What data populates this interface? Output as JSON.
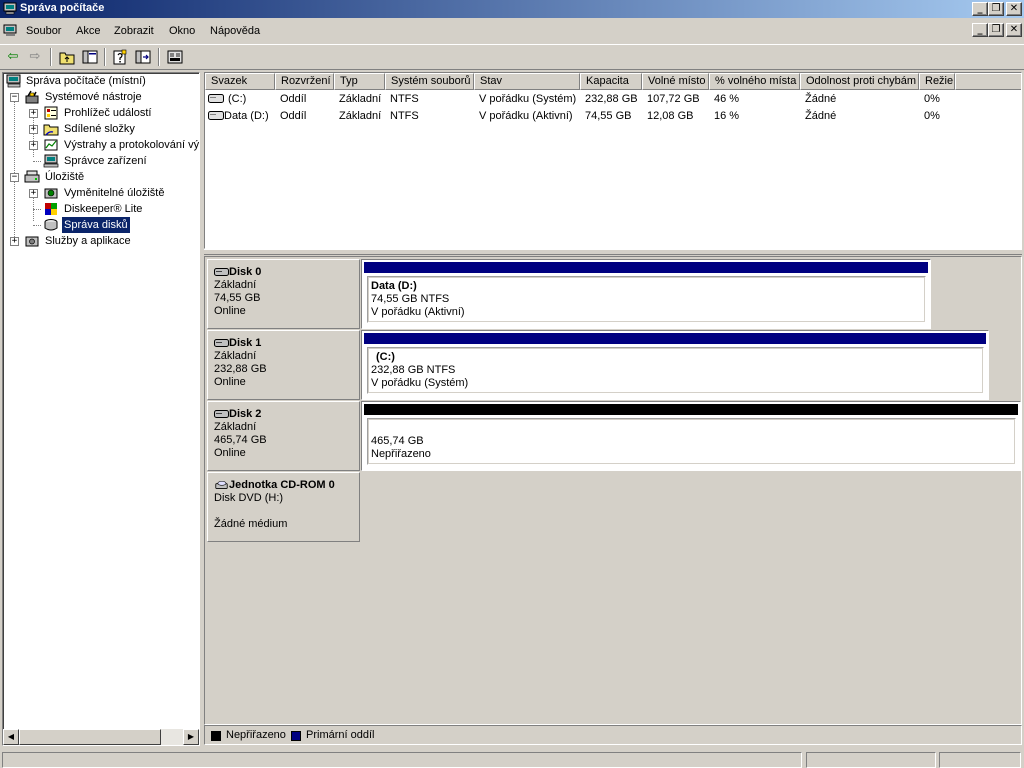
{
  "window": {
    "title": "Správa počítače"
  },
  "menu": {
    "items": [
      "Soubor",
      "Akce",
      "Zobrazit",
      "Okno",
      "Nápověda"
    ]
  },
  "toolbar": {
    "buttons": [
      "back-icon",
      "forward-icon",
      "up-folder-icon",
      "show-hide-tree-icon",
      "properties-icon",
      "export-list-icon",
      "help-icon"
    ]
  },
  "tree": {
    "root": "Správa počítače (místní)",
    "system_tools": "Systémové nástroje",
    "event_viewer": "Prohlížeč událostí",
    "shared_folders": "Sdílené složky",
    "alerts": "Výstrahy a protokolování výk",
    "device_manager": "Správce zařízení",
    "storage": "Úložiště",
    "removable_storage": "Vyměnitelné úložiště",
    "diskeeper": "Diskeeper® Lite",
    "disk_management": "Správa disků",
    "services": "Služby a aplikace"
  },
  "volumes": {
    "headers": [
      "Svazek",
      "Rozvržení",
      "Typ",
      "Systém souborů",
      "Stav",
      "Kapacita",
      "Volné místo",
      "% volného místa",
      "Odolnost proti chybám",
      "Režie"
    ],
    "rows": [
      [
        "(C:)",
        "Oddíl",
        "Základní",
        "NTFS",
        "V pořádku (Systém)",
        "232,88 GB",
        "107,72 GB",
        "46 %",
        "Žádné",
        "0%"
      ],
      [
        "Data (D:)",
        "Oddíl",
        "Základní",
        "NTFS",
        "V pořádku (Aktivní)",
        "74,55 GB",
        "12,08 GB",
        "16 %",
        "Žádné",
        "0%"
      ]
    ]
  },
  "disks": [
    {
      "name": "Disk 0",
      "type": "Základní",
      "size": "74,55 GB",
      "status": "Online",
      "partition": {
        "title": "Data  (D:)",
        "detail": "74,55 GB NTFS",
        "state": "V pořádku (Aktivní)",
        "kind": "primary"
      }
    },
    {
      "name": "Disk 1",
      "type": "Základní",
      "size": "232,88 GB",
      "status": "Online",
      "partition": {
        "title": "(C:)",
        "detail": "232,88 GB NTFS",
        "state": "V pořádku (Systém)",
        "kind": "primary"
      }
    },
    {
      "name": "Disk 2",
      "type": "Základní",
      "size": "465,74 GB",
      "status": "Online",
      "partition": {
        "title": "",
        "detail": "465,74 GB",
        "state": "Nepřiřazeno",
        "kind": "unallocated"
      }
    },
    {
      "name": "Jednotka CD-ROM 0",
      "type": "Disk DVD (H:)",
      "size": "",
      "status": "Žádné médium"
    }
  ],
  "legend": {
    "unallocated": "Nepřiřazeno",
    "primary": "Primární oddíl"
  },
  "colors": {
    "primary": "#000080",
    "unallocated": "#000000",
    "selection": "#0a246a"
  }
}
